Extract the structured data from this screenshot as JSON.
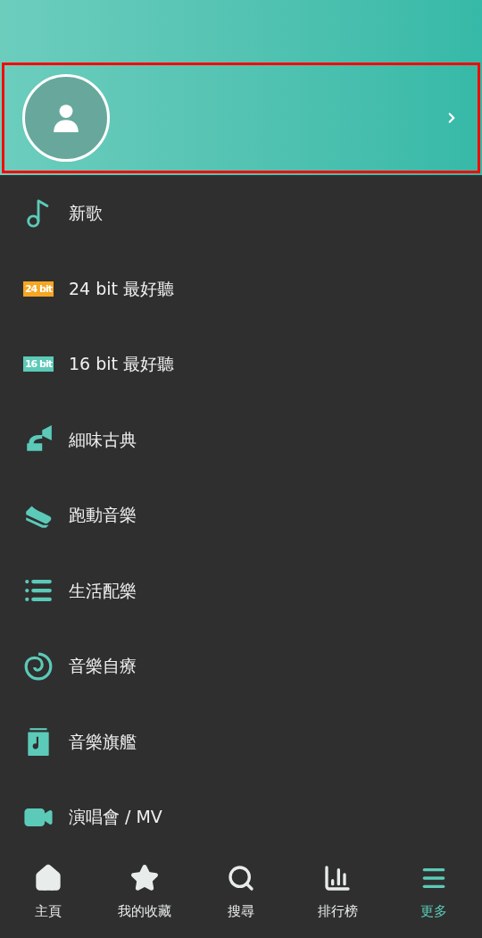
{
  "profile": {
    "highlighted": true
  },
  "menu": [
    {
      "kind": "icon",
      "label": "新歌"
    },
    {
      "kind": "badge",
      "badge": "24 bit",
      "color": "#f5a623",
      "label": "24 bit 最好聽"
    },
    {
      "kind": "badge",
      "badge": "16 bit",
      "color": "#5ccab8",
      "label": "16 bit 最好聽"
    },
    {
      "kind": "icon",
      "label": "細味古典"
    },
    {
      "kind": "icon",
      "label": "跑動音樂"
    },
    {
      "kind": "icon",
      "label": "生活配樂"
    },
    {
      "kind": "icon",
      "label": "音樂自療"
    },
    {
      "kind": "icon",
      "label": "音樂旗艦"
    },
    {
      "kind": "icon",
      "label": "演唱會 / MV"
    }
  ],
  "bottom_nav": [
    {
      "label": "主頁",
      "selected": false
    },
    {
      "label": "我的收藏",
      "selected": false
    },
    {
      "label": "搜尋",
      "selected": false
    },
    {
      "label": "排行榜",
      "selected": false
    },
    {
      "label": "更多",
      "selected": true
    }
  ]
}
